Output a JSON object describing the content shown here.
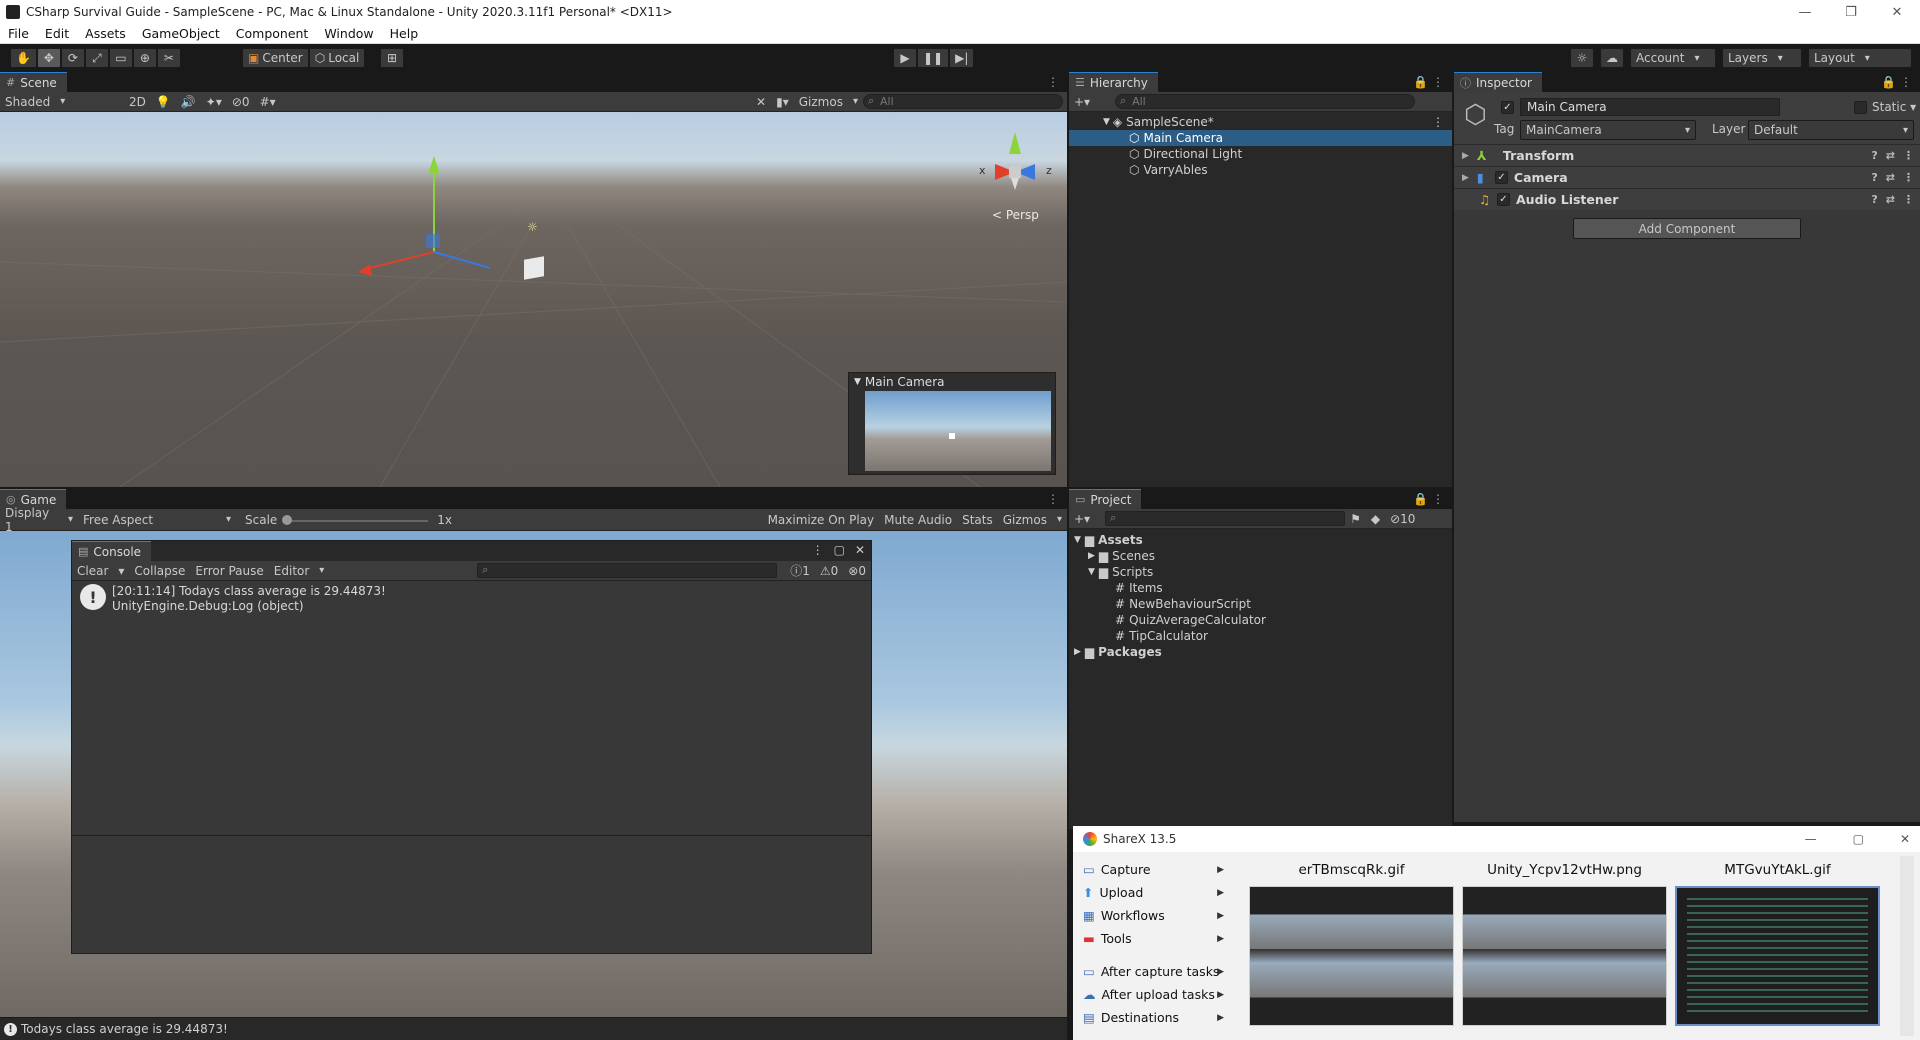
{
  "window": {
    "title": "CSharp Survival Guide - SampleScene - PC, Mac & Linux Standalone - Unity 2020.3.11f1 Personal* <DX11>",
    "controls": [
      "—",
      "❐",
      "✕"
    ]
  },
  "menu": [
    "File",
    "Edit",
    "Assets",
    "GameObject",
    "Component",
    "Window",
    "Help"
  ],
  "toolbar": {
    "center_label": "Center",
    "local_label": "Local",
    "account_label": "Account",
    "layers_label": "Layers",
    "layout_label": "Layout"
  },
  "scene": {
    "tab_label": "Scene",
    "shading_mode": "Shaded",
    "mode_2d": "2D",
    "hidden_count": "0",
    "gizmos_label": "Gizmos",
    "search_placeholder": "All",
    "persp_label": "< Persp",
    "axis_x": "x",
    "axis_z": "z",
    "camera_preview_title": "Main Camera"
  },
  "hierarchy": {
    "tab_label": "Hierarchy",
    "search_placeholder": "All",
    "scene_name": "SampleScene*",
    "items": [
      "Main Camera",
      "Directional Light",
      "VarryAbles"
    ],
    "selected_index": 0
  },
  "inspector": {
    "tab_label": "Inspector",
    "object_name": "Main Camera",
    "static_label": "Static",
    "tag_label": "Tag",
    "tag_value": "MainCamera",
    "layer_label": "Layer",
    "layer_value": "Default",
    "components": [
      {
        "name": "Transform",
        "checkbox": false
      },
      {
        "name": "Camera",
        "checkbox": true
      },
      {
        "name": "Audio Listener",
        "checkbox": true
      }
    ],
    "add_component_label": "Add Component"
  },
  "game": {
    "tab_label": "Game",
    "display": "Display 1",
    "aspect": "Free Aspect",
    "scale_label": "Scale",
    "scale_value": "1x",
    "scale_level": 0,
    "maximize_label": "Maximize On Play",
    "mute_label": "Mute Audio",
    "stats_label": "Stats",
    "gizmos_label": "Gizmos"
  },
  "console": {
    "tab_label": "Console",
    "clear_label": "Clear",
    "collapse_label": "Collapse",
    "error_pause_label": "Error Pause",
    "editor_label": "Editor",
    "count_log": "1",
    "count_warn": "0",
    "count_error": "0",
    "entries": [
      {
        "line1": "[20:11:14] Todays class average is 29.44873!",
        "line2": "UnityEngine.Debug:Log (object)"
      }
    ]
  },
  "project": {
    "tab_label": "Project",
    "hidden_count": "10",
    "tree": {
      "assets": "Assets",
      "scenes": "Scenes",
      "scripts": "Scripts",
      "script_items": [
        "Items",
        "NewBehaviourScript",
        "QuizAverageCalculator",
        "TipCalculator"
      ],
      "packages": "Packages"
    }
  },
  "sharex": {
    "title": "ShareX 13.5",
    "menu": [
      "Capture",
      "Upload",
      "Workflows",
      "Tools",
      "After capture tasks",
      "After upload tasks",
      "Destinations"
    ],
    "thumbnails": [
      "erTBmscqRk.gif",
      "Unity_Ycpv12vtHw.png",
      "MTGvuYtAkL.gif"
    ]
  },
  "status": {
    "message": "Todays class average is 29.44873!"
  },
  "colors": {
    "selection": "#2c5d87",
    "tab_accent": "#2b7fd4",
    "panel_bg": "#282828"
  }
}
